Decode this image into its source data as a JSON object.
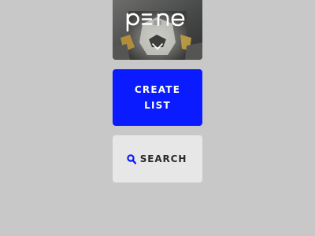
{
  "hero": {
    "logo_text": "pine",
    "image_icon": "robot-photo",
    "expand_icon": "chevron-down-icon"
  },
  "actions": {
    "create_label": "CREATE LIST",
    "search_label": "SEARCH",
    "search_icon": "search-icon"
  },
  "colors": {
    "background": "#c8c8c8",
    "create_bg": "#0a1cff",
    "search_bg": "#e7e7e7",
    "search_icon": "#0a1cff"
  }
}
